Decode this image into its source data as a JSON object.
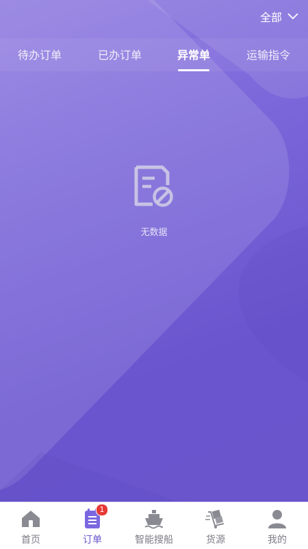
{
  "filter": {
    "label": "全部",
    "icon": "chevron-down-icon"
  },
  "tabs": [
    {
      "label": "待办订单",
      "active": false
    },
    {
      "label": "已办订单",
      "active": false
    },
    {
      "label": "异常单",
      "active": true
    },
    {
      "label": "运输指令",
      "active": false
    }
  ],
  "empty": {
    "icon": "no-data-document-icon",
    "text": "无数据"
  },
  "tabbar": {
    "items": [
      {
        "label": "首页",
        "icon": "home-icon",
        "active": false
      },
      {
        "label": "订单",
        "icon": "order-list-icon",
        "active": true,
        "badge": "1"
      },
      {
        "label": "智能搜船",
        "icon": "ship-icon",
        "active": false
      },
      {
        "label": "货源",
        "icon": "cargo-icon",
        "active": false
      },
      {
        "label": "我的",
        "icon": "user-icon",
        "active": false
      }
    ]
  },
  "colors": {
    "accent": "#6a55cc",
    "background": "#6e5bd0",
    "badge": "#e53935",
    "tabbar_inactive": "#7c7c86"
  }
}
